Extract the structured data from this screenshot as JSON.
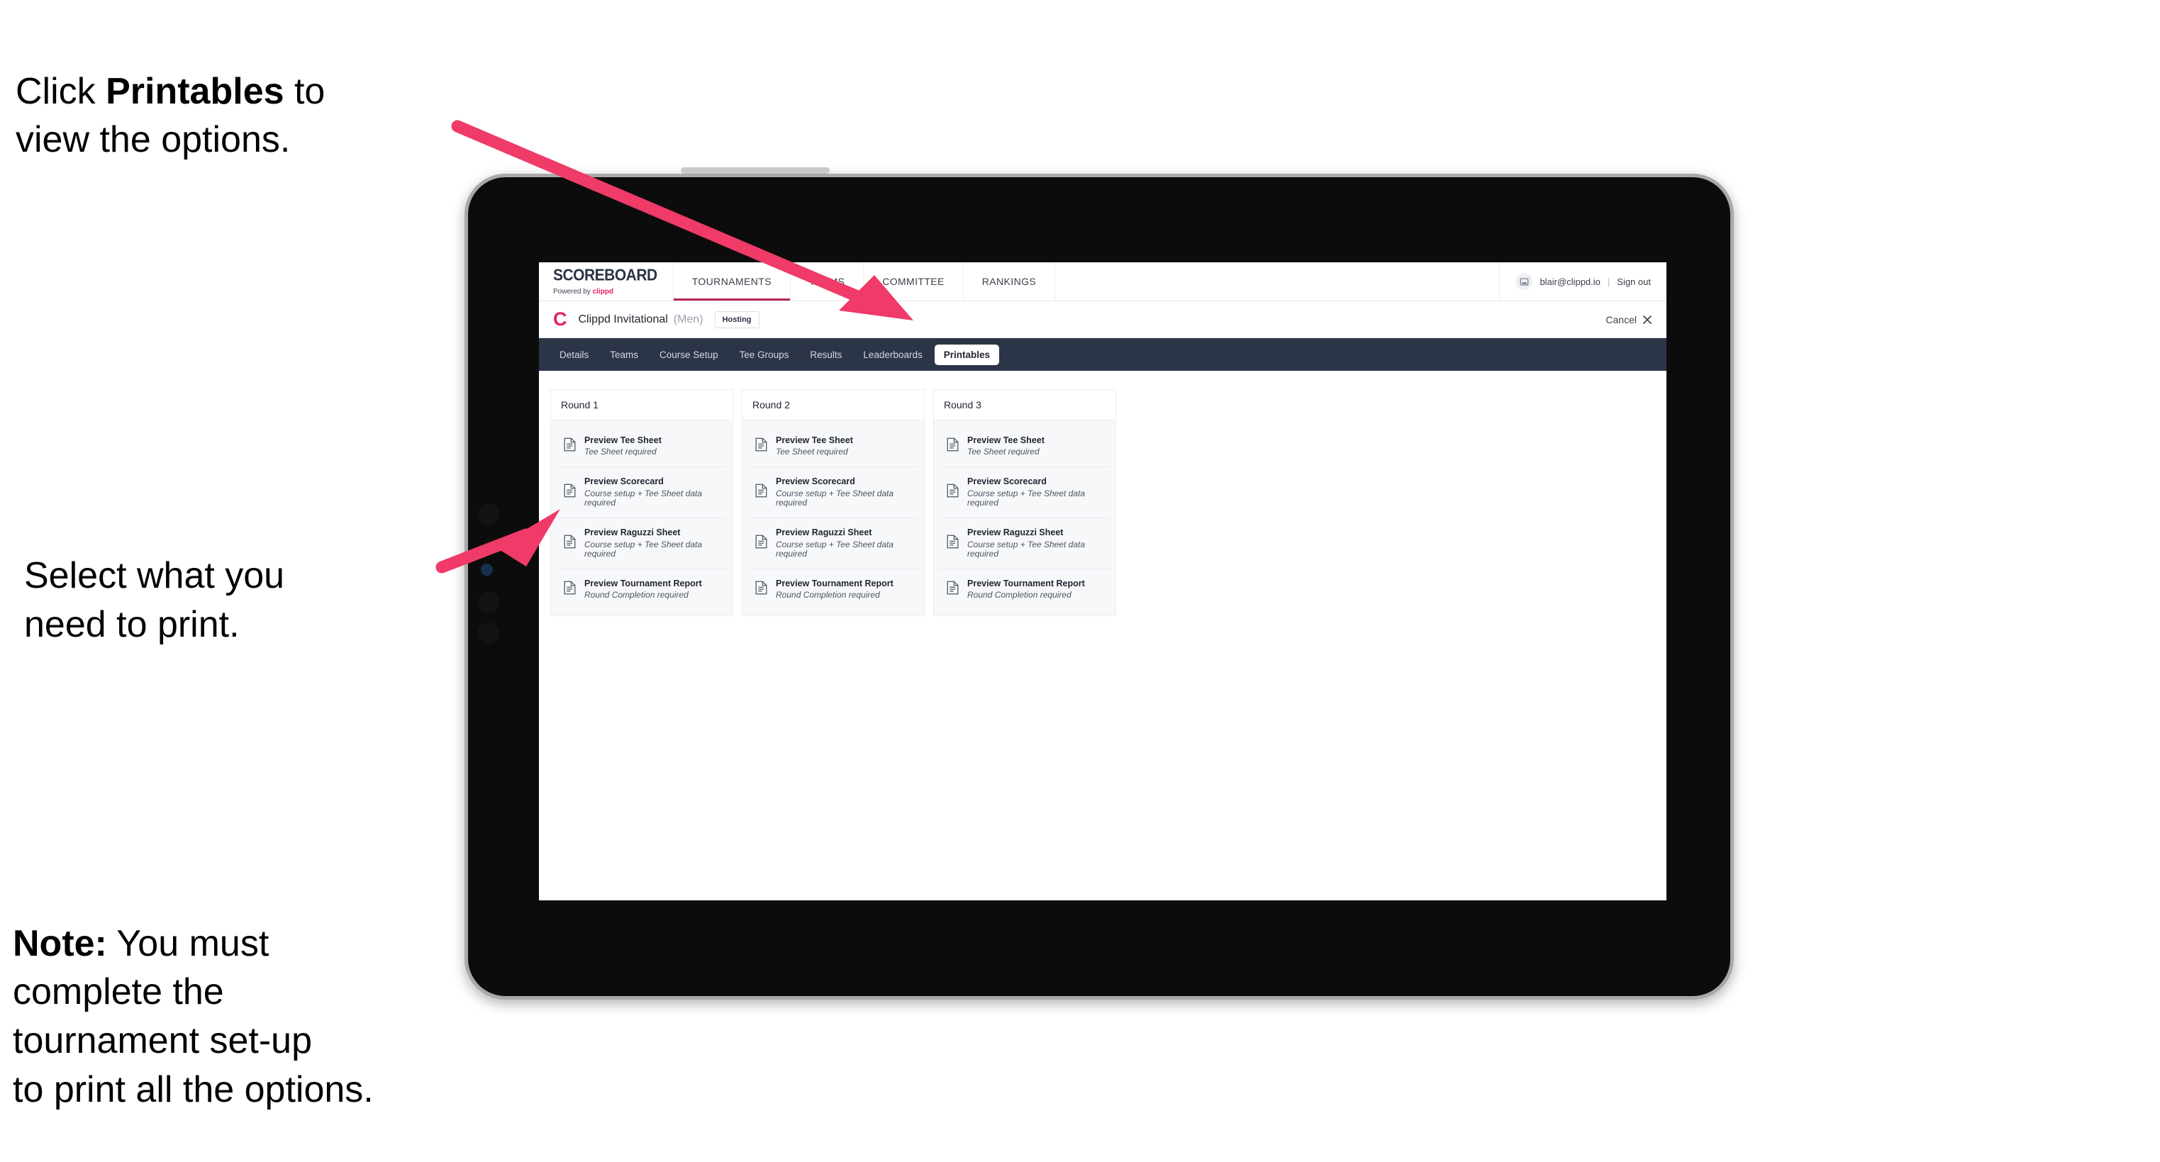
{
  "annotations": {
    "step1_prefix": "Click ",
    "step1_bold": "Printables",
    "step1_suffix": " to\nview the options.",
    "step2": "Select what you\n need to print.",
    "step3_bold": "Note:",
    "step3_rest": " You must\ncomplete the\ntournament set-up\nto print all the options."
  },
  "colors": {
    "accent_pink": "#f03a68",
    "brand_red": "#e0245e",
    "tabstrip_dark": "#2c3547",
    "active_underline": "#b8284f"
  },
  "app": {
    "brand": {
      "title": "SCOREBOARD",
      "powered_prefix": "Powered by ",
      "powered_brand": "clippd"
    },
    "topnav": [
      {
        "label": "TOURNAMENTS",
        "active": true
      },
      {
        "label": "TEAMS",
        "active": false
      },
      {
        "label": "COMMITTEE",
        "active": false
      },
      {
        "label": "RANKINGS",
        "active": false
      }
    ],
    "user": {
      "email": "blair@clippd.io",
      "divider": "|",
      "signout": "Sign out",
      "avatar_icon": "user-avatar-icon"
    },
    "tournament_bar": {
      "logo_letter": "C",
      "name": "Clippd Invitational",
      "gender": "(Men)",
      "badge": "Hosting",
      "cancel_label": "Cancel",
      "cancel_icon": "close-icon"
    },
    "tabs": [
      {
        "label": "Details",
        "active": false
      },
      {
        "label": "Teams",
        "active": false
      },
      {
        "label": "Course Setup",
        "active": false
      },
      {
        "label": "Tee Groups",
        "active": false
      },
      {
        "label": "Results",
        "active": false
      },
      {
        "label": "Leaderboards",
        "active": false
      },
      {
        "label": "Printables",
        "active": true
      }
    ],
    "rounds": [
      {
        "title": "Round 1",
        "items": [
          {
            "title": "Preview Tee Sheet",
            "subtitle": "Tee Sheet required"
          },
          {
            "title": "Preview Scorecard",
            "subtitle": "Course setup + Tee Sheet data required"
          },
          {
            "title": "Preview Raguzzi Sheet",
            "subtitle": "Course setup + Tee Sheet data required"
          },
          {
            "title": "Preview Tournament Report",
            "subtitle": "Round Completion required"
          }
        ]
      },
      {
        "title": "Round 2",
        "items": [
          {
            "title": "Preview Tee Sheet",
            "subtitle": "Tee Sheet required"
          },
          {
            "title": "Preview Scorecard",
            "subtitle": "Course setup + Tee Sheet data required"
          },
          {
            "title": "Preview Raguzzi Sheet",
            "subtitle": "Course setup + Tee Sheet data required"
          },
          {
            "title": "Preview Tournament Report",
            "subtitle": "Round Completion required"
          }
        ]
      },
      {
        "title": "Round 3",
        "items": [
          {
            "title": "Preview Tee Sheet",
            "subtitle": "Tee Sheet required"
          },
          {
            "title": "Preview Scorecard",
            "subtitle": "Course setup + Tee Sheet data required"
          },
          {
            "title": "Preview Raguzzi Sheet",
            "subtitle": "Course setup + Tee Sheet data required"
          },
          {
            "title": "Preview Tournament Report",
            "subtitle": "Round Completion required"
          }
        ]
      }
    ]
  }
}
